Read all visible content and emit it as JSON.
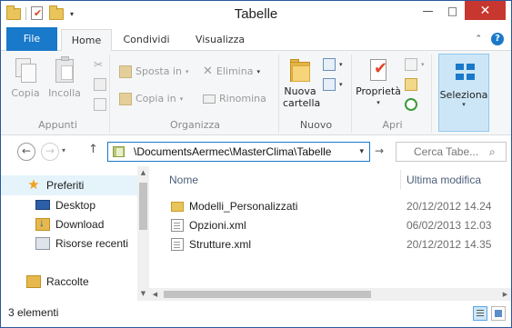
{
  "window": {
    "title": "Tabelle"
  },
  "ribbon_tabs": [
    {
      "label": "File"
    },
    {
      "label": "Home"
    },
    {
      "label": "Condividi"
    },
    {
      "label": "Visualizza"
    }
  ],
  "ribbon": {
    "appunti": {
      "label": "Appunti",
      "copy": "Copia",
      "paste": "Incolla"
    },
    "organizza": {
      "label": "Organizza",
      "move_to": "Sposta in",
      "copy_to": "Copia in",
      "delete": "Elimina",
      "rename": "Rinomina"
    },
    "nuovo": {
      "label": "Nuovo",
      "new_folder_l1": "Nuova",
      "new_folder_l2": "cartella"
    },
    "apri": {
      "label": "Apri",
      "properties": "Proprietà"
    },
    "seleziona": {
      "label": "Seleziona"
    }
  },
  "address": {
    "path": "\\DocumentsAermec\\MasterClima\\Tabelle",
    "search_placeholder": "Cerca Tabe..."
  },
  "nav_pane": {
    "items": [
      {
        "label": "Preferiti",
        "icon": "star-icon"
      },
      {
        "label": "Desktop",
        "icon": "desktop-icon"
      },
      {
        "label": "Download",
        "icon": "download-icon"
      },
      {
        "label": "Risorse recenti",
        "icon": "recent-places-icon"
      },
      {
        "label": "Raccolte",
        "icon": "libraries-icon"
      }
    ]
  },
  "columns": {
    "name": "Nome",
    "modified": "Ultima modifica"
  },
  "files": [
    {
      "name": "Modelli_Personalizzati",
      "modified": "20/12/2012 14.24",
      "icon": "folder-icon"
    },
    {
      "name": "Opzioni.xml",
      "modified": "06/02/2013 12.03",
      "icon": "xml-file-icon"
    },
    {
      "name": "Strutture.xml",
      "modified": "20/12/2012 14.35",
      "icon": "xml-file-icon"
    }
  ],
  "status": {
    "count": "3 elementi"
  },
  "colors": {
    "accent": "#1979ca",
    "close": "#c7372f",
    "selection": "#cde6f7"
  }
}
